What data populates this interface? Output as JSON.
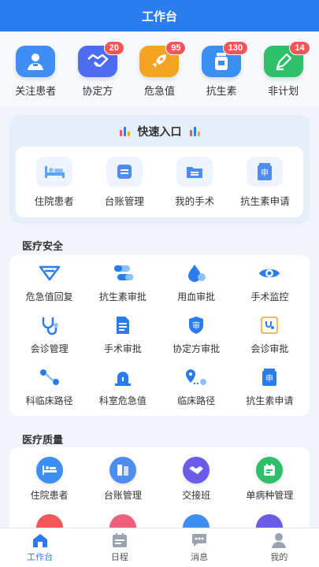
{
  "header": {
    "title": "工作台"
  },
  "top_icons": [
    {
      "label": "关注患者",
      "badge": "",
      "color": "#3f8ff2",
      "icon": "patient-icon"
    },
    {
      "label": "协定方",
      "badge": "20",
      "color": "#4c6df0",
      "icon": "handshake-icon"
    },
    {
      "label": "危急值",
      "badge": "95",
      "color": "#f5a323",
      "icon": "rocket-icon"
    },
    {
      "label": "抗生素",
      "badge": "130",
      "color": "#3b8ff0",
      "icon": "medicine-bottle-icon"
    },
    {
      "label": "非计划",
      "badge": "14",
      "color": "#2fbf6a",
      "icon": "pen-icon"
    }
  ],
  "quick_entry": {
    "title": "快速入口",
    "items": [
      {
        "label": "住院患者",
        "icon": "bed-icon"
      },
      {
        "label": "台账管理",
        "icon": "ledger-icon"
      },
      {
        "label": "我的手术",
        "icon": "folder-icon"
      },
      {
        "label": "抗生素申请",
        "icon": "apply-icon"
      }
    ]
  },
  "medical_safety": {
    "title": "医疗安全",
    "items": [
      {
        "label": "危急值回复",
        "icon": "reply-icon"
      },
      {
        "label": "抗生素审批",
        "icon": "pill-icon"
      },
      {
        "label": "用血审批",
        "icon": "blood-drop-icon"
      },
      {
        "label": "手术监控",
        "icon": "eye-icon"
      },
      {
        "label": "会诊管理",
        "icon": "stethoscope-icon"
      },
      {
        "label": "手术审批",
        "icon": "document-icon"
      },
      {
        "label": "协定方审批",
        "icon": "shield-approve-icon"
      },
      {
        "label": "会诊审批",
        "icon": "consult-board-icon"
      },
      {
        "label": "科临床路径",
        "icon": "route-icon"
      },
      {
        "label": "科室危急值",
        "icon": "alarm-icon"
      },
      {
        "label": "临床路径",
        "icon": "location-route-icon"
      },
      {
        "label": "抗生素申请",
        "icon": "apply-icon"
      }
    ]
  },
  "medical_quality": {
    "title": "医疗质量",
    "items": [
      {
        "label": "住院患者",
        "icon": "bed-icon",
        "color": "#3f8ff2"
      },
      {
        "label": "台账管理",
        "icon": "ledger-icon",
        "color": "#4e8cf2"
      },
      {
        "label": "交接班",
        "icon": "handshake-icon",
        "color": "#6a5ce8"
      },
      {
        "label": "单病种管理",
        "icon": "calendar-icon",
        "color": "#2fbf6a"
      },
      {
        "label": "",
        "icon": "red-icon",
        "color": "#f25656"
      },
      {
        "label": "",
        "icon": "heart-icon",
        "color": "#f0607a"
      },
      {
        "label": "",
        "icon": "home-icon",
        "color": "#3f8ff2"
      },
      {
        "label": "",
        "icon": "purple-icon",
        "color": "#6a5ce8"
      }
    ]
  },
  "tabbar": [
    {
      "label": "工作台",
      "icon": "home-icon",
      "active": true
    },
    {
      "label": "日程",
      "icon": "calendar-icon",
      "active": false
    },
    {
      "label": "消息",
      "icon": "message-icon",
      "active": false
    },
    {
      "label": "我的",
      "icon": "user-icon",
      "active": false
    }
  ],
  "colors": {
    "primary": "#2a7cf0",
    "badge": "#f25656"
  }
}
